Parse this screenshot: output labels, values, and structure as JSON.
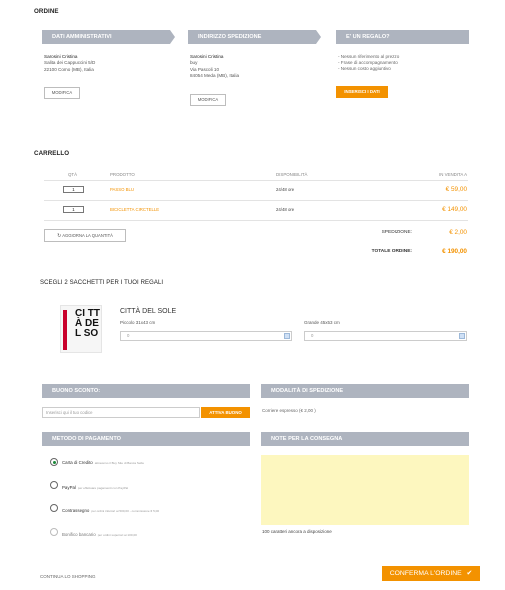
{
  "order": {
    "title": "ORDINE"
  },
  "admin": {
    "header": "DATI AMMINISTRATIVI",
    "lines": [
      "Sarosini Cristina",
      "Salita dei Cappuccini 5/D",
      "22100 Como (MB), Italia"
    ],
    "edit_label": "MODIFICA"
  },
  "shipping": {
    "header": "INDIRIZZO SPEDIZIONE",
    "lines": [
      "Sarosini Cristina",
      "buy",
      "Via Pascoli 10",
      "84054 Meda (MB), Italia"
    ],
    "edit_label": "MODIFICA"
  },
  "gift": {
    "header": "E' UN REGALO?",
    "items": [
      "- Nessun riferimento al prezzo",
      "- Frase di accompagnamento",
      "- Nessun costo aggiuntivo"
    ],
    "button": "INSERISCI I DATI"
  },
  "cart": {
    "title": "CARRELLO",
    "columns": {
      "qty": "QTÀ",
      "product": "PRODOTTO",
      "availability": "DISPONIBILITÀ",
      "price": "IN VENDITA A"
    },
    "rows": [
      {
        "qty": "1",
        "name": "PASSO BLU",
        "availability": "24/48 ore",
        "price": "€ 59,00"
      },
      {
        "qty": "1",
        "name": "BICICLETTA CIRCTELLE",
        "availability": "24/48 ore",
        "price": "€ 149,00"
      }
    ],
    "update_label": "AGGIORNA LA QUANTITÀ",
    "shipping_label": "SPEDIZIONE:",
    "shipping_value": "€ 2,00",
    "total_label": "TOTALE ORDINE:",
    "total_value": "€ 190,00"
  },
  "bags": {
    "title": "SCEGLI 2 SACCHETTI PER I TUOI REGALI",
    "city": "CITTÀ DEL SOLE",
    "image_text": "CI TTÀ DE L SO",
    "small_label": "Piccolo 31x43 cm",
    "large_label": "Grande 45x53 cm",
    "small_value": "0",
    "large_value": "0"
  },
  "discount": {
    "header": "BUONO SCONTO:",
    "placeholder": "Inserisci qui il tuo codice",
    "button": "ATTIVA BUONO"
  },
  "ship_mode": {
    "header": "MODALITÀ DI SPEDIZIONE",
    "value": "Corriere espresso (€ 2,00 )"
  },
  "payment": {
    "header": "METODO DI PAGAMENTO",
    "methods": [
      {
        "name": "Carta di Credito",
        "note": "attraverso il Buy Site di Banca Sella"
      },
      {
        "name": "PayPal",
        "note": "per effettuare pagamenti con PayPal"
      },
      {
        "name": "Contrassegno",
        "note": "per ordini inferiori ai 500,00 - commissione € 5,00"
      },
      {
        "name": "Bonifico bancario",
        "note": "per ordini superiori ai 100,00"
      }
    ]
  },
  "notes": {
    "header": "NOTE PER LA CONSEGNA",
    "counter": "100 caratteri ancora a disposizione"
  },
  "footer": {
    "continue": "CONTINUA LO SHOPPING",
    "confirm": "CONFERMA L'ORDINE"
  },
  "colors": {
    "accent": "#f39200",
    "bar": "#aeb4bf",
    "notes_bg": "#fdf7bf"
  }
}
